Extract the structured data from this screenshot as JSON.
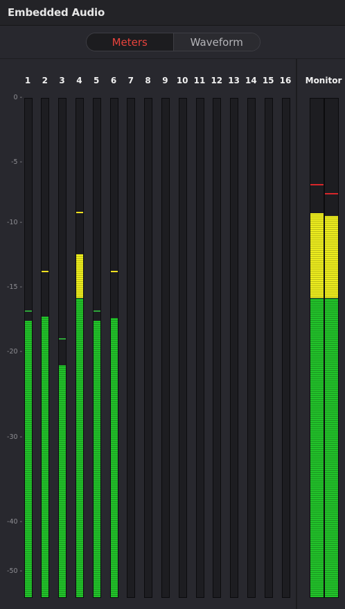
{
  "panel": {
    "title": "Embedded Audio"
  },
  "tabs": {
    "meters": "Meters",
    "waveform": "Waveform"
  },
  "colors": {
    "active_tab_text": "#e8433c",
    "level_green": "#22c22a",
    "level_yellow": "#ecec1e",
    "peak_green": "#2ea63a",
    "peak_yellow": "#f0e020",
    "peak_red": "#d8262a"
  },
  "scale_labels": [
    "0 -",
    "-5 -",
    "-10 -",
    "-15 -",
    "-20 -",
    "-30 -",
    "-40 -",
    "-50 -"
  ],
  "channels": [
    {
      "label": "1",
      "level_db": -17.5,
      "peak_db": -16.8,
      "peak_color": "green"
    },
    {
      "label": "2",
      "level_db": -17.2,
      "peak_db": -13.7,
      "peak_color": "yellow"
    },
    {
      "label": "3",
      "level_db": -21.5,
      "peak_db": -18.9,
      "peak_color": "green"
    },
    {
      "label": "4",
      "level_db": -12.4,
      "peak_db": -9.1,
      "peak_color": "yellow"
    },
    {
      "label": "5",
      "level_db": -17.5,
      "peak_db": -16.8,
      "peak_color": "green"
    },
    {
      "label": "6",
      "level_db": -17.3,
      "peak_db": -13.7,
      "peak_color": "yellow"
    },
    {
      "label": "7",
      "level_db": null,
      "peak_db": null,
      "peak_color": null
    },
    {
      "label": "8",
      "level_db": null,
      "peak_db": null,
      "peak_color": null
    },
    {
      "label": "9",
      "level_db": null,
      "peak_db": null,
      "peak_color": null
    },
    {
      "label": "10",
      "level_db": null,
      "peak_db": null,
      "peak_color": null
    },
    {
      "label": "11",
      "level_db": null,
      "peak_db": null,
      "peak_color": null
    },
    {
      "label": "12",
      "level_db": null,
      "peak_db": null,
      "peak_color": null
    },
    {
      "label": "13",
      "level_db": null,
      "peak_db": null,
      "peak_color": null
    },
    {
      "label": "14",
      "level_db": null,
      "peak_db": null,
      "peak_color": null
    },
    {
      "label": "15",
      "level_db": null,
      "peak_db": null,
      "peak_color": null
    },
    {
      "label": "16",
      "level_db": null,
      "peak_db": null,
      "peak_color": null
    }
  ],
  "monitor": {
    "label": "Monitor",
    "channels": [
      {
        "level_db": -9.2,
        "peak_db": -6.8,
        "peak_color": "red"
      },
      {
        "level_db": -9.4,
        "peak_db": -7.5,
        "peak_color": "red"
      }
    ]
  },
  "yellow_threshold_db": -15.8
}
